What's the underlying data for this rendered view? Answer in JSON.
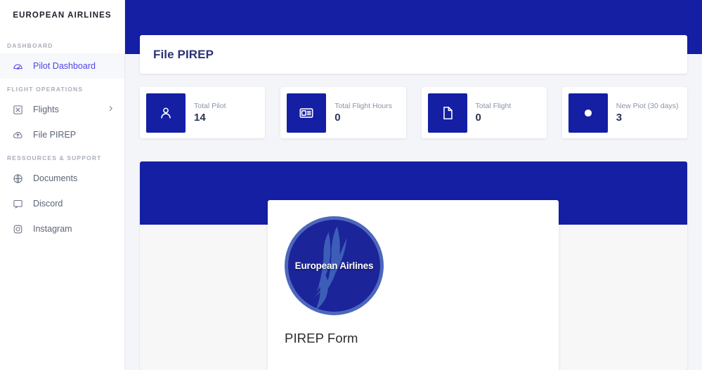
{
  "sidebar": {
    "brand": "EUROPEAN AIRLINES",
    "sections": [
      {
        "title": "DASHBOARD",
        "items": [
          {
            "label": "Pilot Dashboard",
            "icon": "gauge-icon",
            "active": true,
            "chevron": false
          }
        ]
      },
      {
        "title": "FLIGHT OPERATIONS",
        "items": [
          {
            "label": "Flights",
            "icon": "plane-icon",
            "active": false,
            "chevron": true
          },
          {
            "label": "File PIREP",
            "icon": "cloud-upload-icon",
            "active": false,
            "chevron": false
          }
        ]
      },
      {
        "title": "RESSOURCES & SUPPORT",
        "items": [
          {
            "label": "Documents",
            "icon": "globe-icon",
            "active": false,
            "chevron": false
          },
          {
            "label": "Discord",
            "icon": "chat-icon",
            "active": false,
            "chevron": false
          },
          {
            "label": "Instagram",
            "icon": "instagram-icon",
            "active": false,
            "chevron": false
          }
        ]
      }
    ]
  },
  "header": {
    "title": "File PIREP"
  },
  "stats": [
    {
      "label": "Total Pilot",
      "value": "14",
      "icon": "user-icon"
    },
    {
      "label": "Total Flight Hours",
      "value": "0",
      "icon": "id-card-icon"
    },
    {
      "label": "Total Flight",
      "value": "0",
      "icon": "document-icon"
    },
    {
      "label": "New Piot (30 days)",
      "value": "3",
      "icon": "circle-icon"
    }
  ],
  "form": {
    "logo_text": "European Airlines",
    "title": "PIREP Form"
  },
  "colors": {
    "brand_blue": "#141fa4",
    "accent_indigo": "#4f46e5",
    "page_background": "#f4f5f9",
    "panel_background": "#f7f7f7",
    "label_muted": "#8b93a7",
    "value_navy": "#2b3356",
    "title_navy": "#2b3372",
    "logo_ring": "#4d67bd",
    "logo_fill": "#1b2499"
  }
}
